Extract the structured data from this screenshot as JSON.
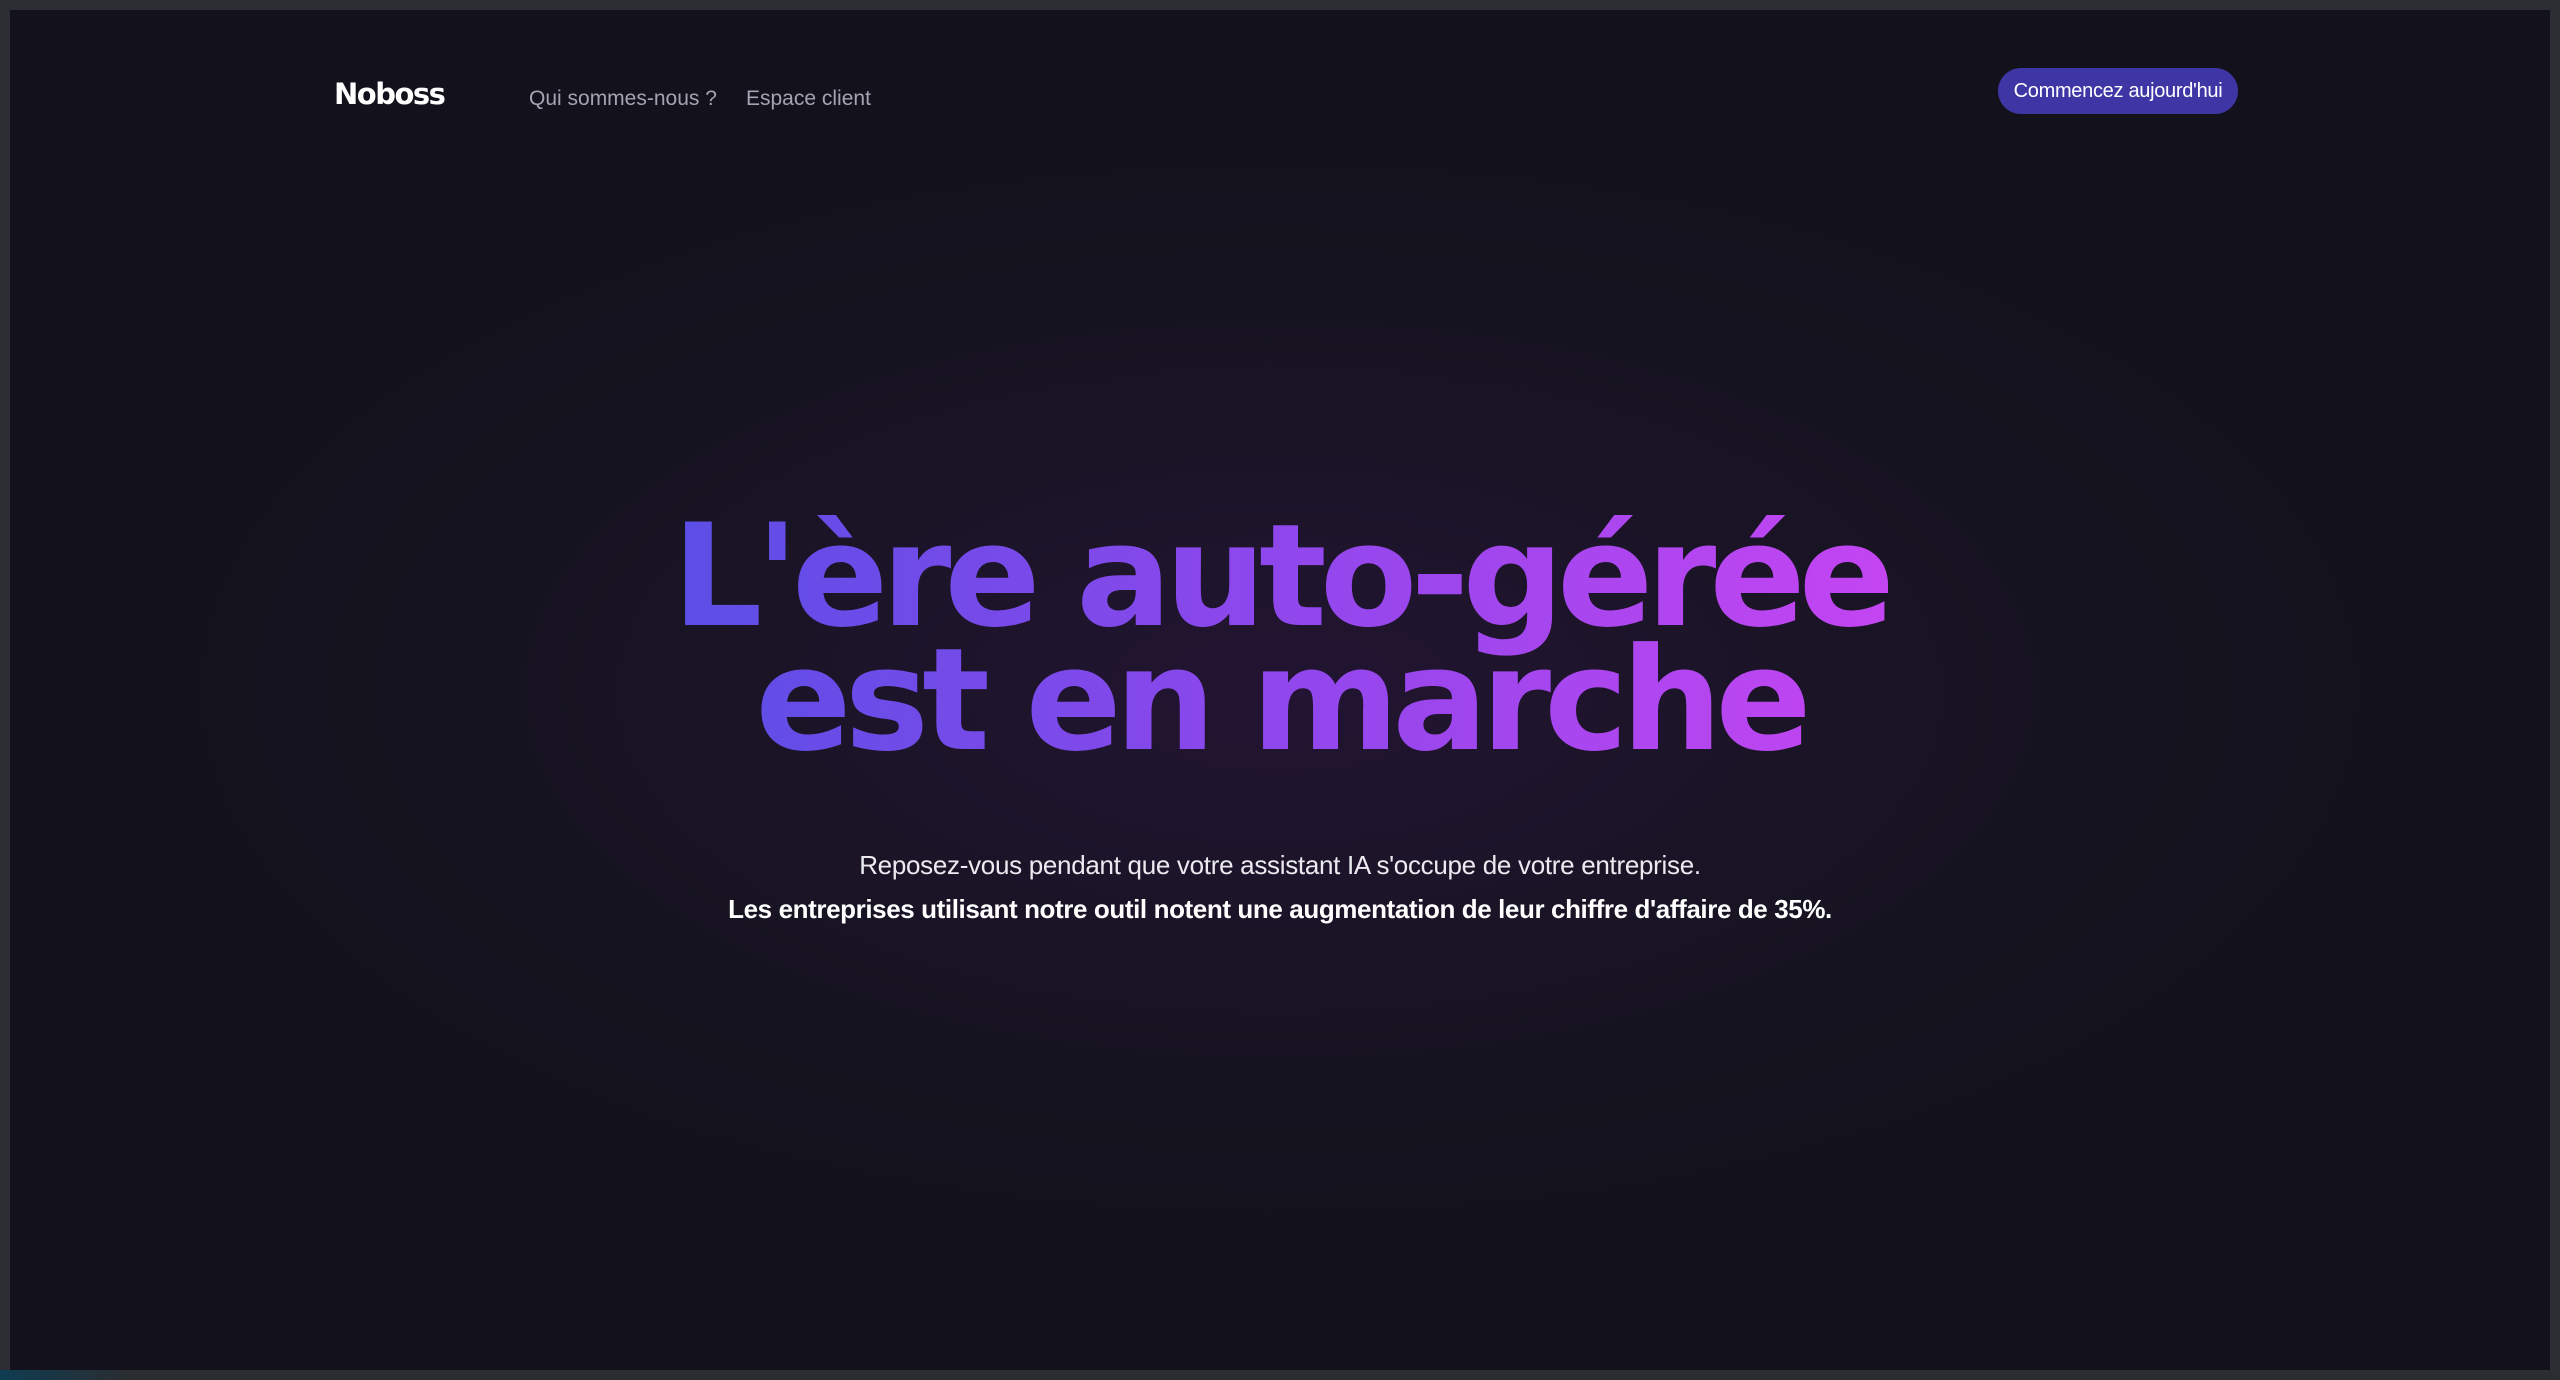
{
  "nav": {
    "logo": "Noboss",
    "links": [
      {
        "label": "Qui sommes-nous ?"
      },
      {
        "label": "Espace client"
      }
    ],
    "cta_label": "Commencez aujourd'hui"
  },
  "hero": {
    "title_line1": "L'ère auto-gérée",
    "title_line2": "est en marche",
    "subtitle": "Reposez-vous pendant que votre assistant IA s'occupe de votre entreprise.",
    "highlight": "Les entreprises utilisant notre outil notent une augmentation de leur chiffre d'affaire de 35%."
  },
  "colors": {
    "background": "#13121c",
    "accent_button": "#3f36a6",
    "gradient_start": "#5b4ee6",
    "gradient_end": "#c445f2",
    "nav_link": "#a5a3b0"
  }
}
